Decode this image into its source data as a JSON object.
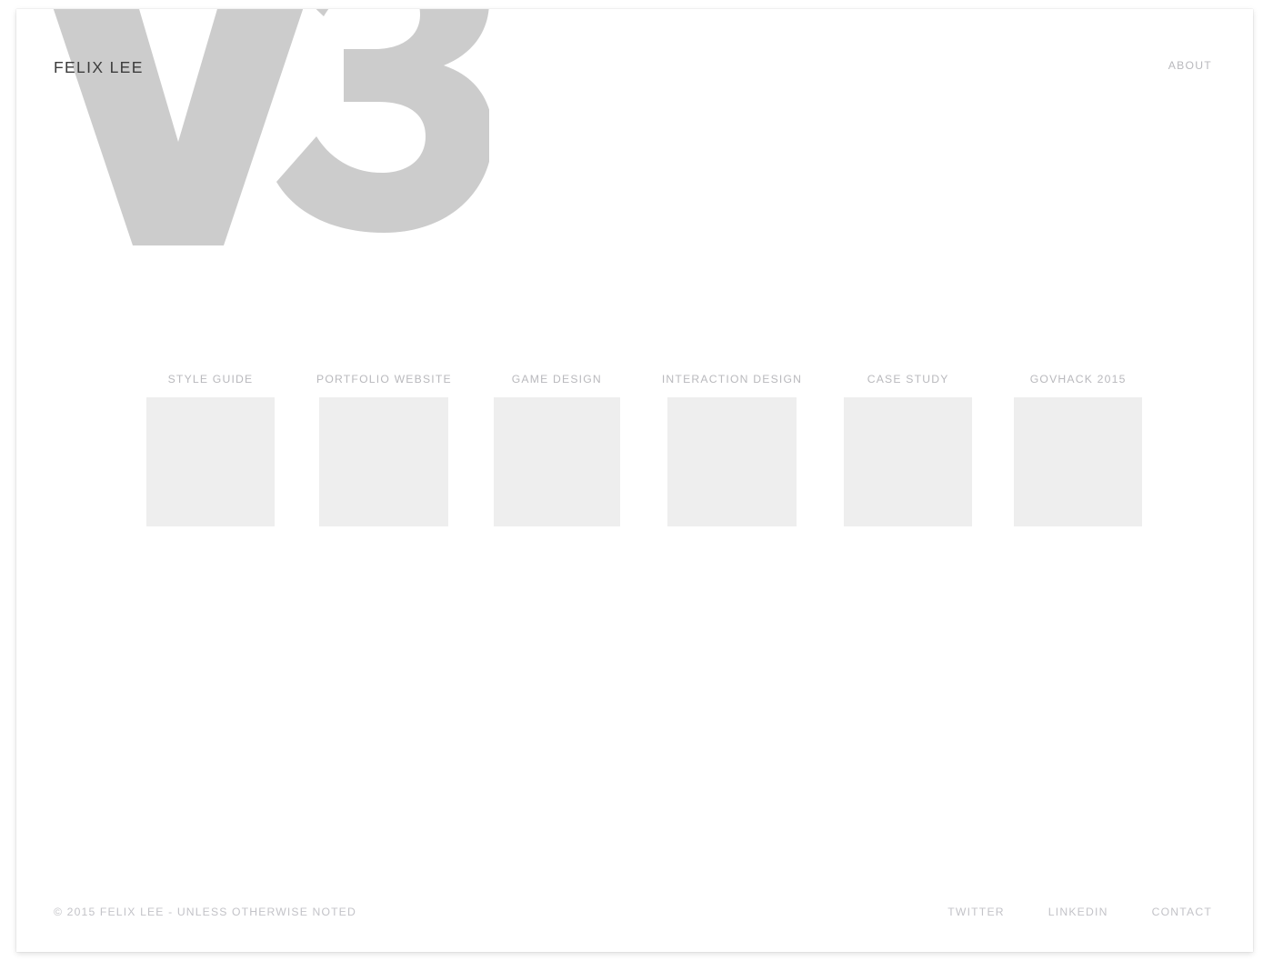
{
  "site": {
    "brand": "FELIX LEE",
    "logomark_text": "V3",
    "logomark_color": "#cccccc",
    "background_color": "#ffffff",
    "muted_text_color": "#b9b9bd",
    "brand_text_color": "#3c3c3c",
    "thumb_color": "#eeeeee"
  },
  "topnav": {
    "items": [
      {
        "label": "ABOUT"
      }
    ]
  },
  "projects": {
    "items": [
      {
        "label": "STYLE GUIDE"
      },
      {
        "label": "PORTFOLIO WEBSITE"
      },
      {
        "label": "GAME DESIGN"
      },
      {
        "label": "INTERACTION DESIGN"
      },
      {
        "label": "CASE STUDY"
      },
      {
        "label": "GOVHACK 2015"
      }
    ]
  },
  "footer": {
    "copyright": "© 2015 FELIX LEE - UNLESS OTHERWISE NOTED",
    "links": [
      {
        "label": "TWITTER"
      },
      {
        "label": "LINKEDIN"
      },
      {
        "label": "CONTACT"
      }
    ]
  }
}
